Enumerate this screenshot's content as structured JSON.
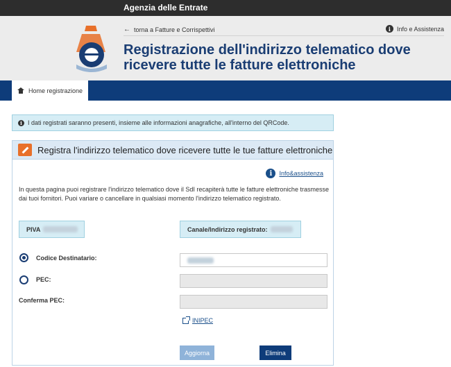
{
  "topbar": {
    "brand": "Agenzia delle Entrate"
  },
  "header": {
    "back_link": "torna a Fatture e Corrispettivi",
    "info_link": "Info e Assistenza",
    "title": "Registrazione dell'indirizzo telematico dove ricevere tutte le fatture elettroniche"
  },
  "nav": {
    "home_tab": "Home registrazione"
  },
  "alert": {
    "text": "I dati registrati saranno presenti, insieme alle informazioni anagrafiche, all'interno del QRCode."
  },
  "panel": {
    "title": "Registra l'indirizzo telematico dove ricevere tutte le tue fatture elettroniche",
    "help_link": "Info&assistenza",
    "description": "In questa pagina puoi registrare l'indirizzo telematico dove il SdI recapiterà tutte le fatture elettroniche trasmesse dai tuoi fornitori. Puoi variare o cancellare in qualsiasi momento l'indirizzo telematico registrato.",
    "piva_label": "PIVA",
    "canale_label": "Canale/Indirizzo registrato:",
    "codice_label": "Codice Destinatario:",
    "pec_label": "PEC:",
    "conferma_label": "Conferma PEC:",
    "inipec_link": "INIPEC",
    "aggiorna_button": "Aggiorna",
    "elimina_button": "Elimina",
    "selected_option": "Codice Destinatario"
  },
  "colors": {
    "primary": "#0e3c7a",
    "title": "#1a3d73",
    "accent": "#e8702a",
    "info_bg": "#d6edf5"
  },
  "icons": [
    "agenzia-logo-icon",
    "arrow-left-icon",
    "info-icon",
    "home-icon",
    "pencil-icon",
    "external-link-icon",
    "radio-icon"
  ]
}
